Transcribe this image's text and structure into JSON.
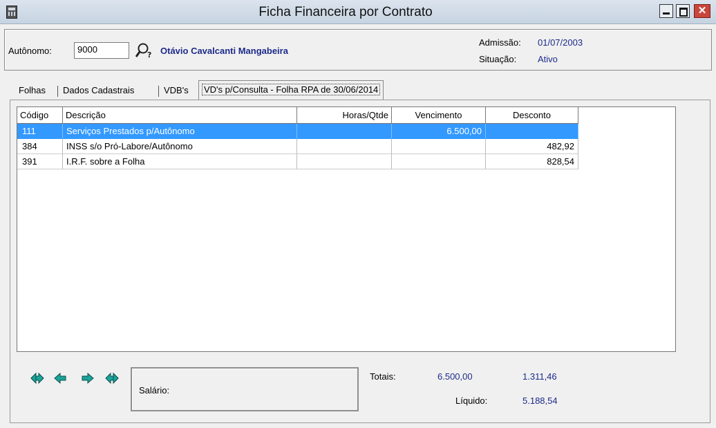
{
  "window": {
    "title": "Ficha Financeira por Contrato",
    "close_glyph": "✕"
  },
  "header": {
    "autonomo_label": "Autônomo:",
    "autonomo_value": "9000",
    "name": "Otávio Cavalcanti Mangabeira",
    "admissao_label": "Admissão:",
    "admissao_value": "01/07/2003",
    "situacao_label": "Situação:",
    "situacao_value": "Ativo"
  },
  "tabs": [
    {
      "label": "Folhas"
    },
    {
      "label": "Dados Cadastrais"
    },
    {
      "label": "VDB's"
    },
    {
      "label": "VD's p/Consulta - Folha RPA de 30/06/2014",
      "active": true
    }
  ],
  "grid": {
    "columns": [
      "Código",
      "Descrição",
      "Horas/Qtde",
      "Vencimento",
      "Desconto"
    ],
    "rows": [
      {
        "codigo": "111",
        "descricao": "Serviços Prestados p/Autônomo",
        "horas": "",
        "vencimento": "6.500,00",
        "desconto": "",
        "selected": true
      },
      {
        "codigo": "384",
        "descricao": "INSS s/o Pró-Labore/Autônomo",
        "horas": "",
        "vencimento": "",
        "desconto": "482,92"
      },
      {
        "codigo": "391",
        "descricao": "I.R.F. sobre a Folha",
        "horas": "",
        "vencimento": "",
        "desconto": "828,54"
      }
    ]
  },
  "footer": {
    "salario_label": "Salário:",
    "totais_label": "Totais:",
    "totais_vencimento": "6.500,00",
    "totais_desconto": "1.311,46",
    "liquido_label": "Líquido:",
    "liquido_value": "5.188,54"
  },
  "colors": {
    "selection": "#3399ff",
    "value_blue": "#1c2a8a",
    "arrow_teal": "#1aa39a"
  }
}
